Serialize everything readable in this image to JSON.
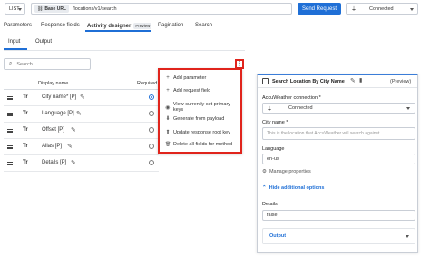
{
  "request": {
    "method": "LIST",
    "base_url_label": "Base URL",
    "path": "/locations/v1/search",
    "send_label": "Send Request",
    "connection": "Connected"
  },
  "tabs": [
    "Parameters",
    "Response fields",
    "Activity designer",
    "Pagination",
    "Search"
  ],
  "preview_badge": "Preview",
  "subtabs": [
    "Input",
    "Output"
  ],
  "search": {
    "placeholder": "Search"
  },
  "table": {
    "col_display": "Display name",
    "col_required": "Required",
    "rows": [
      {
        "type": "Tr",
        "name": "City name* [P]",
        "required": true
      },
      {
        "type": "Tr",
        "name": "Language [P]",
        "required": false
      },
      {
        "type": "Tr",
        "name": "Offset [P]",
        "required": false
      },
      {
        "type": "Tr",
        "name": "Alias [P]",
        "required": false
      },
      {
        "type": "Tr",
        "name": "Details [P]",
        "required": false
      }
    ]
  },
  "menu": {
    "items": [
      {
        "icon": "plus-icon",
        "glyph": "+",
        "label": "Add parameter"
      },
      {
        "icon": "plus-icon",
        "glyph": "+",
        "label": "Add request field"
      },
      {
        "icon": "eye-icon",
        "glyph": "◉",
        "label": "View currently set primary keys"
      },
      {
        "icon": "download-icon",
        "glyph": "⬇",
        "label": "Generate from payload"
      },
      {
        "icon": "upload-icon",
        "glyph": "⬆",
        "label": "Update response root key"
      },
      {
        "icon": "trash-icon",
        "glyph": "🗑",
        "label": "Delete all fields for method"
      }
    ]
  },
  "panel": {
    "title": "Search Location By City Name",
    "preview_label": "(Preview)",
    "connection_label": "AccuWeather connection *",
    "connection_value": "Connected",
    "city_label": "City name *",
    "city_placeholder": "This is the location that AccuWeather will search against.",
    "language_label": "Language",
    "language_value": "en-us",
    "manage_label": "Manage properties",
    "hide_label": "Hide additional options",
    "details_label": "Details",
    "details_value": "false",
    "output_label": "Output"
  },
  "colors": {
    "accent": "#1f6fd6",
    "menu_border": "#e0241c"
  }
}
